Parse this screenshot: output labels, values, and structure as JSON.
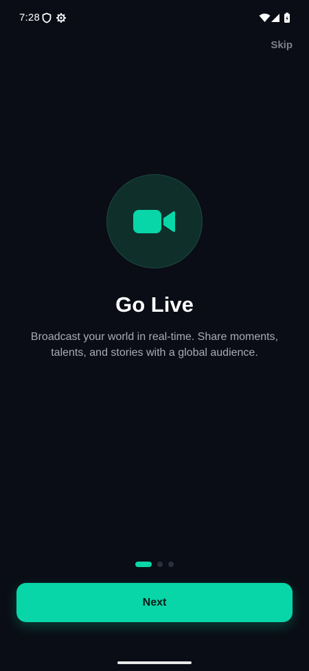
{
  "status_bar": {
    "time": "7:28",
    "icons": [
      "shield-icon",
      "settings-gear-icon",
      "wifi-icon",
      "signal-icon",
      "battery-icon"
    ]
  },
  "header": {
    "skip_label": "Skip"
  },
  "hero": {
    "icon": "video-camera-icon",
    "title": "Go Live",
    "description": "Broadcast your world in real-time. Share moments, talents, and stories with a global audience."
  },
  "pagination": {
    "total": 3,
    "current": 1
  },
  "actions": {
    "next_label": "Next"
  },
  "colors": {
    "background": "#0a0d15",
    "accent": "#08d6a8",
    "muted_text": "#a9acb4",
    "skip_text": "#7d808a",
    "icon_circle": "#0f2f2b"
  }
}
